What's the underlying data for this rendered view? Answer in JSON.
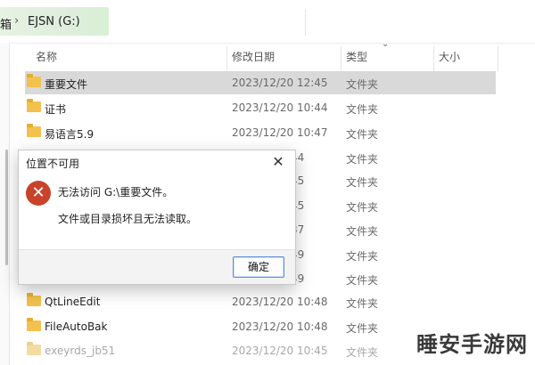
{
  "address_bar": {
    "root_fragment": "箱",
    "separator": "›",
    "drive": "EJSN (G:)"
  },
  "columns": {
    "name": "名称",
    "date": "修改日期",
    "type": "类型",
    "size": "大小"
  },
  "rows": [
    {
      "name": "重要文件",
      "date": "2023/12/20 12:45",
      "type": "文件夹"
    },
    {
      "name": "证书",
      "date": "2023/12/20 10:44",
      "type": "文件夹"
    },
    {
      "name": "易语言5.9",
      "date": "2023/12/20 10:47",
      "type": "文件夹"
    },
    {
      "name": "",
      "date": "44",
      "type": "文件夹"
    },
    {
      "name": "",
      "date": "45",
      "type": "文件夹"
    },
    {
      "name": "",
      "date": "45",
      "type": "文件夹"
    },
    {
      "name": "",
      "date": "37",
      "type": "文件夹"
    },
    {
      "name": "",
      "date": "49",
      "type": "文件夹"
    },
    {
      "name": "",
      "date": "49",
      "type": "文件夹"
    },
    {
      "name": "QtLineEdit",
      "date": "2023/12/20 10:48",
      "type": "文件夹"
    },
    {
      "name": "FileAutoBak",
      "date": "2023/12/20 10:48",
      "type": "文件夹"
    },
    {
      "name": "exeyrds_jb51",
      "date": "2023/12/20 10:45",
      "type": "文件夹"
    }
  ],
  "dialog": {
    "title": "位置不可用",
    "close_glyph": "✕",
    "error_glyph": "✕",
    "message_line1": "无法访问 G:\\重要文件。",
    "message_line2": "文件或目录损坏且无法读取。",
    "ok_label": "确定"
  },
  "watermark": "睡安手游网"
}
